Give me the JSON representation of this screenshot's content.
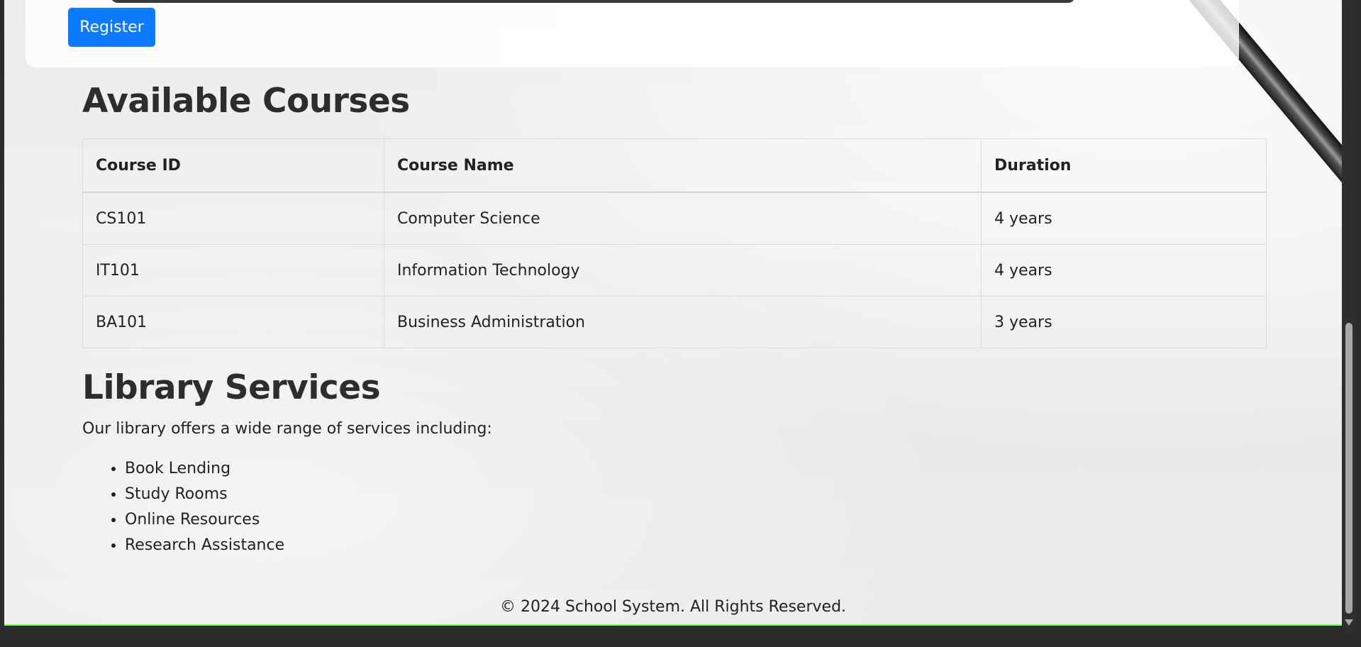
{
  "form": {
    "register_label": "Register"
  },
  "courses": {
    "title": "Available Courses",
    "headers": [
      "Course ID",
      "Course Name",
      "Duration"
    ],
    "rows": [
      [
        "CS101",
        "Computer Science",
        "4 years"
      ],
      [
        "IT101",
        "Information Technology",
        "4 years"
      ],
      [
        "BA101",
        "Business Administration",
        "3 years"
      ]
    ]
  },
  "library": {
    "title": "Library Services",
    "description": "Our library offers a wide range of services including:",
    "services": [
      "Book Lending",
      "Study Rooms",
      "Online Resources",
      "Research Assistance"
    ]
  },
  "footer": {
    "text": "© 2024 School System. All Rights Reserved."
  },
  "colors": {
    "primary": "#0d7bff",
    "status_bar": "#22dd00"
  }
}
